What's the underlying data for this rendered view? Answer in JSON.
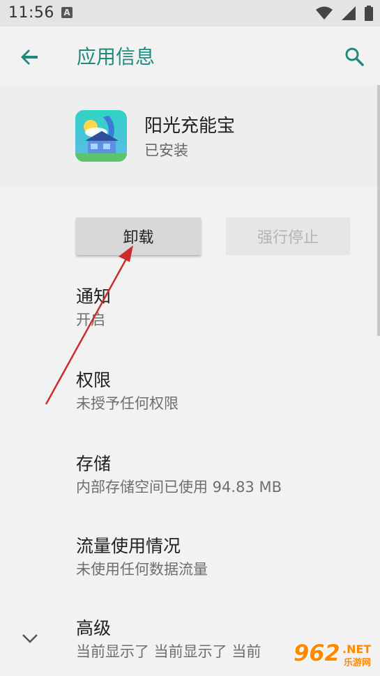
{
  "status_bar": {
    "time": "11:56",
    "notification_letter": "A",
    "icons": [
      "wifi-icon",
      "signal-icon",
      "battery-icon"
    ]
  },
  "app_bar": {
    "title": "应用信息"
  },
  "app": {
    "name": "阳光充能宝",
    "status": "已安装"
  },
  "buttons": {
    "uninstall": "卸载",
    "force_stop": "强行停止"
  },
  "settings": [
    {
      "title": "通知",
      "subtitle": "开启"
    },
    {
      "title": "权限",
      "subtitle": "未授予任何权限"
    },
    {
      "title": "存储",
      "subtitle": "内部存储空间已使用 94.83 MB"
    },
    {
      "title": "流量使用情况",
      "subtitle": "未使用任何数据流量"
    },
    {
      "title": "高级",
      "subtitle": "当前显示了 当前显示了 当前"
    }
  ],
  "watermark": {
    "number": "962",
    "domain": ".NET",
    "site": "乐游网"
  },
  "colors": {
    "accent": "#1e8a7e",
    "annotation_arrow": "#cc2b2b",
    "watermark": "#ff8a00"
  }
}
